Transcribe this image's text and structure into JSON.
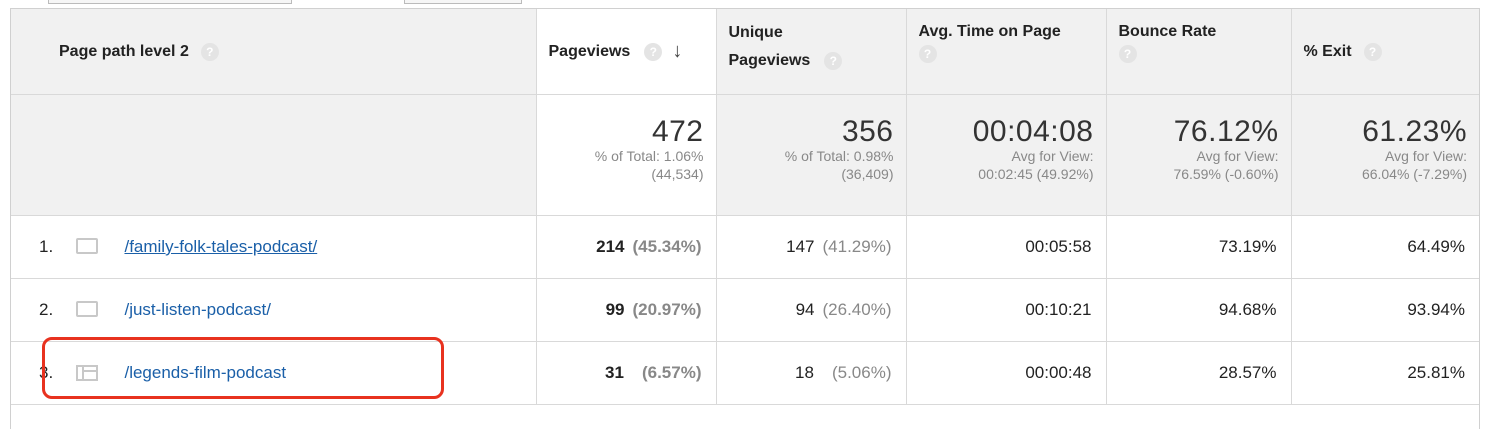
{
  "table": {
    "headers": {
      "page_path": "Page path level 2",
      "pageviews": "Pageviews",
      "unique_line1": "Unique",
      "unique_line2": "Pageviews",
      "avg_time": "Avg. Time on Page",
      "bounce": "Bounce Rate",
      "exit": "% Exit",
      "help_glyph": "?",
      "sort_glyph": "↓"
    },
    "totals": {
      "pageviews": {
        "value": "472",
        "sub1": "% of Total: 1.06%",
        "sub2": "(44,534)"
      },
      "unique": {
        "value": "356",
        "sub1": "% of Total: 0.98%",
        "sub2": "(36,409)"
      },
      "avg_time": {
        "value": "00:04:08",
        "sub1": "Avg for View:",
        "sub2": "00:02:45 (49.92%)"
      },
      "bounce": {
        "value": "76.12%",
        "sub1": "Avg for View:",
        "sub2": "76.59% (-0.60%)"
      },
      "exit": {
        "value": "61.23%",
        "sub1": "Avg for View:",
        "sub2": "66.04% (-7.29%)"
      }
    },
    "rows": [
      {
        "index": "1.",
        "icon": "folder-icon",
        "path": "/family-folk-tales-podcast/",
        "pageviews": "214",
        "pageviews_pct": "(45.34%)",
        "unique": "147",
        "unique_pct": "(41.29%)",
        "avg_time": "00:05:58",
        "bounce": "73.19%",
        "exit": "64.49%"
      },
      {
        "index": "2.",
        "icon": "folder-icon",
        "path": "/just-listen-podcast/",
        "pageviews": "99",
        "pageviews_pct": "(20.97%)",
        "unique": "94",
        "unique_pct": "(26.40%)",
        "avg_time": "00:10:21",
        "bounce": "94.68%",
        "exit": "93.94%"
      },
      {
        "index": "3.",
        "icon": "page-icon",
        "path": "/legends-film-podcast",
        "pageviews": "31",
        "pageviews_pct": "(6.57%)",
        "unique": "18",
        "unique_pct": "(5.06%)",
        "avg_time": "00:00:48",
        "bounce": "28.57%",
        "exit": "25.81%"
      }
    ]
  },
  "colors": {
    "link": "#1a5fa8",
    "highlight": "#e8321f",
    "header_bg": "#f1f1f1"
  }
}
